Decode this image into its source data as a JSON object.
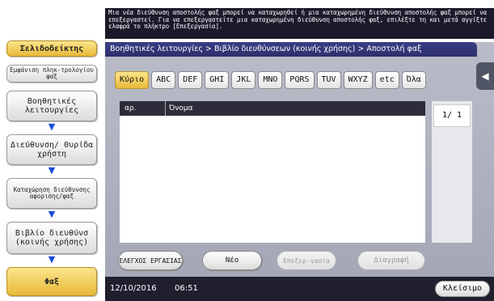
{
  "message": "Μια νέα διεύθυνση αποστολής φαξ μπορεί να καταχωρηθεί ή μια καταχωρημένη διεύθυνση αποστολής φαξ μπορεί να επεξεργαστεί. Για να επεξεργαστείτε μια καταχωρημένη διεύθυνση αποστολής φαξ, επιλέξτε τη και μετά αγγίξτε ελαφρά το πλήκτρο [Επεξεργασία].",
  "sidebar": {
    "bookmark": "Σελιδοδείκτης",
    "fax_memory_display": "Εμφάνιση πληκ-τρολογίου φαξ",
    "steps": [
      {
        "label": "Βοηθητικές λειτουργίες"
      },
      {
        "label": "Διεύθυνση/ Θυρίδα χρήστη"
      },
      {
        "label": "Καταχώρηση διεύθυνσης αφορισης/φαξ"
      },
      {
        "label": "Βιβλίο διευθύνσ (κοινής χρήσης)"
      },
      {
        "label": "Φαξ"
      }
    ]
  },
  "breadcrumb": "Βοηθητικές λειτουργίες > Βιβλίο διευθύνσεων (κοινής χρήσης) > Αποστολή φαξ",
  "tabs": [
    "Κύριο",
    "ABC",
    "DEF",
    "GHI",
    "JKL",
    "MNO",
    "PQRS",
    "TUV",
    "WXYZ",
    "etc",
    "Όλα"
  ],
  "active_tab": "Κύριο",
  "list": {
    "columns": {
      "number": "αρ.",
      "name": "Όνομα"
    },
    "rows": []
  },
  "pager": {
    "current": "1/",
    "total": "1"
  },
  "buttons": {
    "check_job": "ΕΛΕΓΧΟΣ ΕΡΓΑΣΙΑΣ",
    "new": "Νέο",
    "edit": "Επεξερ-γασία",
    "delete": "Διαγραφή"
  },
  "status": {
    "date": "12/10/2016",
    "time": "06:51",
    "close": "Κλείσιμο"
  },
  "colors": {
    "accent_gold": "#f0c64a",
    "header_navy": "#343776",
    "panel_grey": "#b0b3c0"
  }
}
